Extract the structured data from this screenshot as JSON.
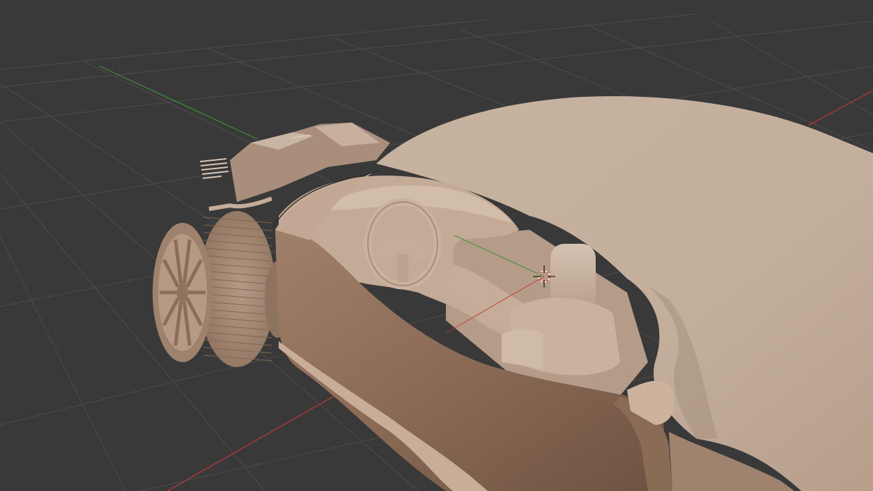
{
  "app": {
    "name": "",
    "view": "3D Viewport"
  },
  "viewport": {
    "background_color": "#393939",
    "grid_color": "#4d4d4d",
    "x_axis_color": "#c4373a",
    "y_axis_color": "#3f8e3a",
    "cursor_color": "#ff3b3b",
    "object": {
      "description_icon": "car-model",
      "shading": "solid",
      "base_color": "#c0a692"
    }
  }
}
